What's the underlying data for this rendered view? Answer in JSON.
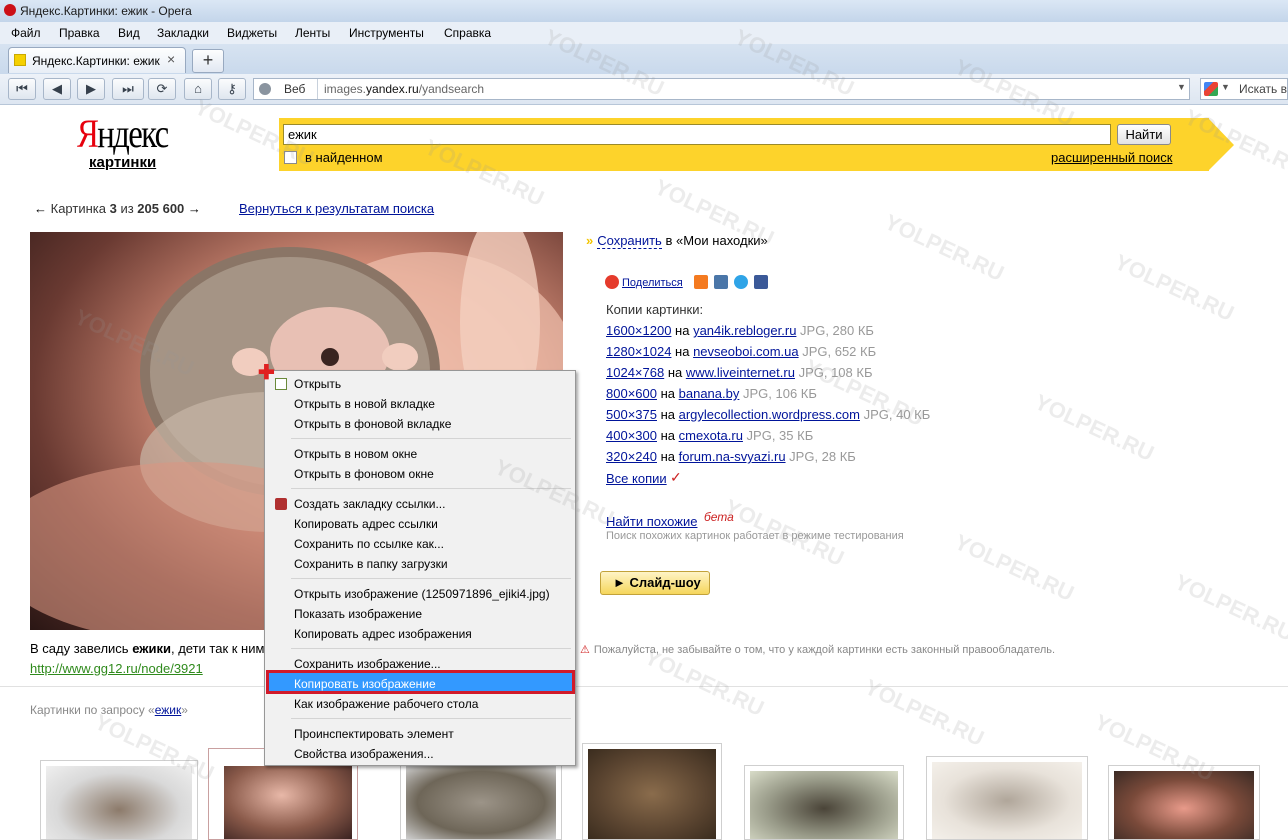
{
  "window": {
    "title": "Яндекс.Картинки: ежик - Opera"
  },
  "menu": [
    "Файл",
    "Правка",
    "Вид",
    "Закладки",
    "Виджеты",
    "Ленты",
    "Инструменты",
    "Справка"
  ],
  "tab": {
    "label": "Яндекс.Картинки: ежик",
    "close": "×"
  },
  "newtab_label": "+",
  "address": {
    "web_label": "Веб",
    "url_prefix": "images.",
    "url_domain": "yandex.ru",
    "url_path": "/yandsearch"
  },
  "websearch": {
    "placeholder": "Искать в"
  },
  "logo": {
    "first_letter": "Я",
    "rest": "ндекс",
    "subtitle": "картинки"
  },
  "search": {
    "query": "ежик",
    "button": "Найти",
    "checkbox_label": "в найденном",
    "advanced": "расширенный поиск"
  },
  "nav": {
    "prev_arrow": "←",
    "text_before": "Картинка ",
    "current": "3",
    "text_mid": " из ",
    "total": "205 600",
    "next_arrow": "→",
    "back_link": "Вернуться к результатам поиска"
  },
  "caption": {
    "before": "В саду завелись ",
    "bold": "ежики",
    "after": ", дети так к ним",
    "source": "http://www.gg12.ru/node/3921"
  },
  "save": {
    "link": "Сохранить",
    "rest": " в «Мои находки»"
  },
  "share": {
    "label": "Поделиться"
  },
  "copies": {
    "title": "Копии картинки:",
    "rows": [
      {
        "size": "1600×1200",
        "on": " на ",
        "site": "yan4ik.rebloger.ru",
        "meta": " JPG, 280 КБ"
      },
      {
        "size": "1280×1024",
        "on": " на ",
        "site": "nevseoboi.com.ua",
        "meta": " JPG, 652 КБ"
      },
      {
        "size": "1024×768",
        "on": " на ",
        "site": "www.liveinternet.ru",
        "meta": " JPG, 108 КБ"
      },
      {
        "size": "800×600",
        "on": " на ",
        "site": "banana.by",
        "meta": " JPG, 106 КБ"
      },
      {
        "size": "500×375",
        "on": " на ",
        "site": "argylecollection.wordpress.com",
        "meta": " JPG, 40 КБ"
      },
      {
        "size": "400×300",
        "on": " на ",
        "site": "cmexota.ru",
        "meta": " JPG, 35 КБ"
      },
      {
        "size": "320×240",
        "on": " на ",
        "site": "forum.na-svyazi.ru",
        "meta": " JPG, 28 КБ"
      }
    ],
    "all": "Все копии",
    "all_mark": "✓"
  },
  "similar": {
    "link": "Найти похожие",
    "beta": "бета",
    "note": "Поиск похожих картинок работает в режиме тестирования"
  },
  "slideshow": "► Слайд-шоу",
  "warning": "Пожалуйста, не забывайте о том, что у каждой картинки есть законный правообладатель.",
  "related": {
    "before": "Картинки по запросу «",
    "query": "ежик",
    "after": "»"
  },
  "context_menu": {
    "items": [
      "Открыть",
      "Открыть в новой вкладке",
      "Открыть в фоновой вкладке",
      "Открыть в новом окне",
      "Открыть в фоновом окне",
      "Создать закладку ссылки...",
      "Копировать адрес ссылки",
      "Сохранить по ссылке как...",
      "Сохранить в папку загрузки",
      "Открыть изображение (1250971896_ejiki4.jpg)",
      "Показать изображение",
      "Копировать адрес изображения",
      "Сохранить изображение...",
      "Копировать изображение",
      "Как изображение рабочего стола",
      "Проинспектировать элемент",
      "Свойства изображения..."
    ],
    "selected_index": 13
  },
  "watermark": "YOLPER.RU",
  "colors": {
    "yandex_yellow": "#fdd32b",
    "link": "#00149a",
    "selection": "#3399ff",
    "highlight_frame": "#d11a2a"
  }
}
